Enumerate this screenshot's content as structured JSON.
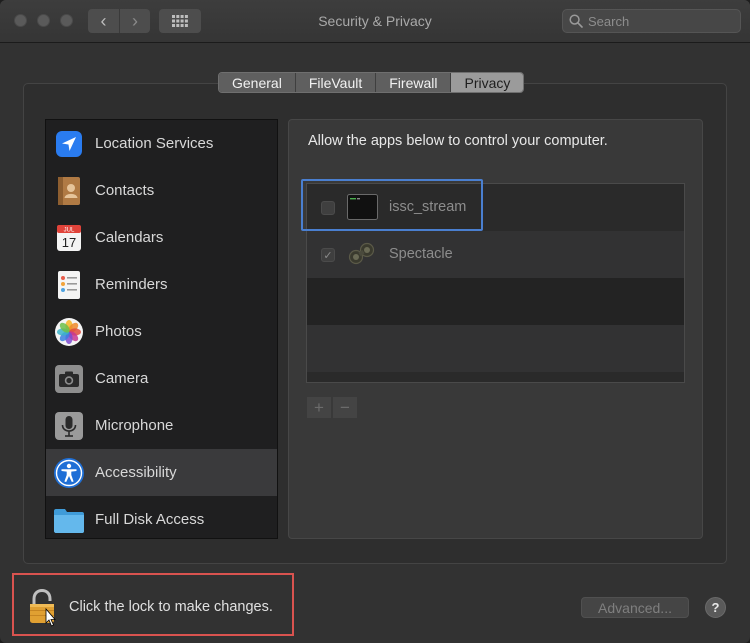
{
  "window": {
    "title": "Security & Privacy"
  },
  "toolbar": {
    "back_glyph": "‹",
    "forward_glyph": "›",
    "search_placeholder": "Search"
  },
  "tabs": [
    {
      "label": "General",
      "selected": false
    },
    {
      "label": "FileVault",
      "selected": false
    },
    {
      "label": "Firewall",
      "selected": false
    },
    {
      "label": "Privacy",
      "selected": true
    }
  ],
  "sidebar": {
    "items": [
      {
        "label": "Location Services",
        "icon": "location-arrow-icon",
        "selected": false
      },
      {
        "label": "Contacts",
        "icon": "contacts-book-icon",
        "selected": false
      },
      {
        "label": "Calendars",
        "icon": "calendar-icon",
        "selected": false,
        "calendar_month": "JUL",
        "calendar_day": "17"
      },
      {
        "label": "Reminders",
        "icon": "reminders-icon",
        "selected": false
      },
      {
        "label": "Photos",
        "icon": "photos-icon",
        "selected": false
      },
      {
        "label": "Camera",
        "icon": "camera-icon",
        "selected": false
      },
      {
        "label": "Microphone",
        "icon": "microphone-icon",
        "selected": false
      },
      {
        "label": "Accessibility",
        "icon": "accessibility-icon",
        "selected": true
      },
      {
        "label": "Full Disk Access",
        "icon": "folder-icon",
        "selected": false
      }
    ]
  },
  "panel": {
    "heading": "Allow the apps below to control your computer.",
    "apps": [
      {
        "name": "issc_stream",
        "checked": false,
        "icon": "terminal-app-icon"
      },
      {
        "name": "Spectacle",
        "checked": true,
        "icon": "spectacle-binoculars-icon"
      }
    ],
    "add_label": "+",
    "remove_label": "−"
  },
  "footer": {
    "lock_text": "Click the lock to make changes.",
    "advanced_label": "Advanced...",
    "help_label": "?"
  },
  "colors": {
    "highlight_blue": "#4a7fd0",
    "highlight_red": "#d9534f",
    "selected_row": "#3a3a3c"
  }
}
